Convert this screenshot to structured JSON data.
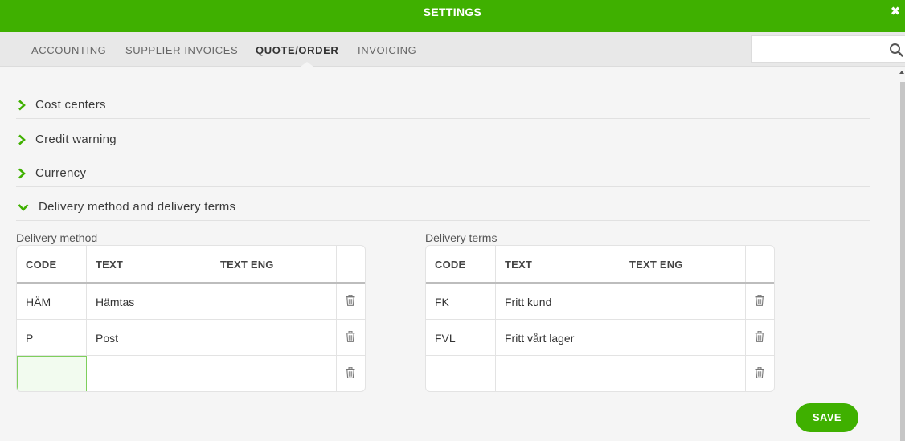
{
  "window": {
    "title": "SETTINGS"
  },
  "tabs": [
    {
      "label": "ACCOUNTING"
    },
    {
      "label": "SUPPLIER INVOICES"
    },
    {
      "label": "QUOTE/ORDER",
      "active": true
    },
    {
      "label": "INVOICING"
    }
  ],
  "search": {
    "value": "",
    "placeholder": ""
  },
  "sections": [
    {
      "label": "Cost centers",
      "expanded": false
    },
    {
      "label": "Credit warning",
      "expanded": false
    },
    {
      "label": "Currency",
      "expanded": false
    },
    {
      "label": "Delivery method and delivery terms",
      "expanded": true
    }
  ],
  "delivery_method": {
    "label": "Delivery method",
    "columns": [
      "CODE",
      "TEXT",
      "TEXT ENG"
    ],
    "rows": [
      {
        "code": "HÄM",
        "text": "Hämtas",
        "text_eng": ""
      },
      {
        "code": "P",
        "text": "Post",
        "text_eng": ""
      },
      {
        "code": "",
        "text": "",
        "text_eng": ""
      }
    ]
  },
  "delivery_terms": {
    "label": "Delivery terms",
    "columns": [
      "CODE",
      "TEXT",
      "TEXT ENG"
    ],
    "rows": [
      {
        "code": "FK",
        "text": "Fritt kund",
        "text_eng": ""
      },
      {
        "code": "FVL",
        "text": "Fritt vårt lager",
        "text_eng": ""
      },
      {
        "code": "",
        "text": "",
        "text_eng": ""
      }
    ]
  },
  "save_label": "SAVE",
  "icons": {
    "close": "close-icon",
    "search": "search-icon",
    "chevron": "chevron-icon",
    "delete": "trash-icon"
  },
  "colors": {
    "accent": "#3fb000",
    "editing_cell": "#7ecf5c"
  }
}
